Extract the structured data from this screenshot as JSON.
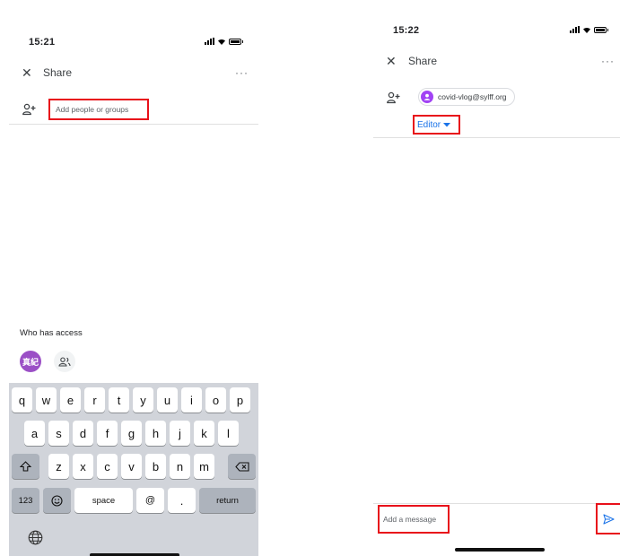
{
  "left_screen": {
    "status": {
      "time": "15:21"
    },
    "header": {
      "title": "Share",
      "close_icon": "close-icon",
      "more_icon": "more-horiz-icon"
    },
    "add_people": {
      "icon": "person-add-icon",
      "placeholder": "Add people or groups"
    },
    "access": {
      "heading": "Who has access",
      "avatar_text": "真紀",
      "group_icon": "group-icon"
    },
    "keyboard": {
      "row1": [
        "q",
        "w",
        "e",
        "r",
        "t",
        "y",
        "u",
        "i",
        "o",
        "p"
      ],
      "row2": [
        "a",
        "s",
        "d",
        "f",
        "g",
        "h",
        "j",
        "k",
        "l"
      ],
      "row3": [
        "z",
        "x",
        "c",
        "v",
        "b",
        "n",
        "m"
      ],
      "shift_icon": "shift-icon",
      "backspace_icon": "backspace-icon",
      "numbers_key": "123",
      "emoji_icon": "emoji-icon",
      "space_key": "space",
      "at_key": "@",
      "dot_key": ".",
      "return_key": "return",
      "globe_icon": "globe-icon"
    }
  },
  "right_screen": {
    "status": {
      "time": "15:22"
    },
    "header": {
      "title": "Share",
      "close_icon": "close-icon",
      "more_icon": "more-horiz-icon"
    },
    "recipient": {
      "icon": "person-add-icon",
      "email": "covid-vlog@sylff.org",
      "avatar_icon": "account-circle-icon"
    },
    "role": {
      "label": "Editor",
      "dropdown_icon": "caret-down-icon"
    },
    "message": {
      "placeholder": "Add a message",
      "send_icon": "send-icon"
    }
  },
  "colors": {
    "highlight": "#e8101a",
    "accent": "#1a73e8",
    "avatar": "#9b4fc6"
  }
}
